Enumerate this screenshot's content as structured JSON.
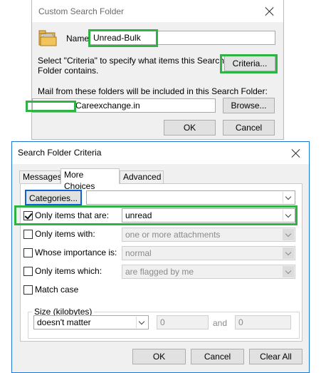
{
  "custom_dialog": {
    "title": "Custom Search Folder",
    "name_label": "Name:",
    "name_value": "Unread-Bulk",
    "criteria_text_line1": "Select \"Criteria\" to specify what items this Search",
    "criteria_text_line2": "Folder contains.",
    "criteria_button": "Criteria...",
    "folders_label": "Mail from these folders will be included in this Search Folder:",
    "folder_value": "Careexchange.in",
    "browse_button": "Browse...",
    "ok_button": "OK",
    "cancel_button": "Cancel"
  },
  "criteria_dialog": {
    "title": "Search Folder Criteria",
    "tabs": [
      "Messages",
      "More Choices",
      "Advanced"
    ],
    "active_tab": "More Choices",
    "categories_button": "Categories...",
    "categories_value": "",
    "rows": [
      {
        "label": "Only items that are:",
        "checked": true,
        "value": "unread",
        "enabled": true
      },
      {
        "label": "Only items with:",
        "checked": false,
        "value": "one or more attachments",
        "enabled": false
      },
      {
        "label": "Whose importance is:",
        "checked": false,
        "value": "normal",
        "enabled": false
      },
      {
        "label": "Only items which:",
        "checked": false,
        "value": "are flagged by me",
        "enabled": false
      }
    ],
    "match_case_label": "Match case",
    "match_case_checked": false,
    "size_group_label": "Size (kilobytes)",
    "size_value": "doesn't matter",
    "size_from": "0",
    "size_and": "and",
    "size_to": "0",
    "ok_button": "OK",
    "cancel_button": "Cancel",
    "clear_all_button": "Clear All"
  },
  "colors": {
    "highlight": "#2fb344",
    "dialog_border": "#1c78d4",
    "button_face": "#e1e1e1"
  }
}
